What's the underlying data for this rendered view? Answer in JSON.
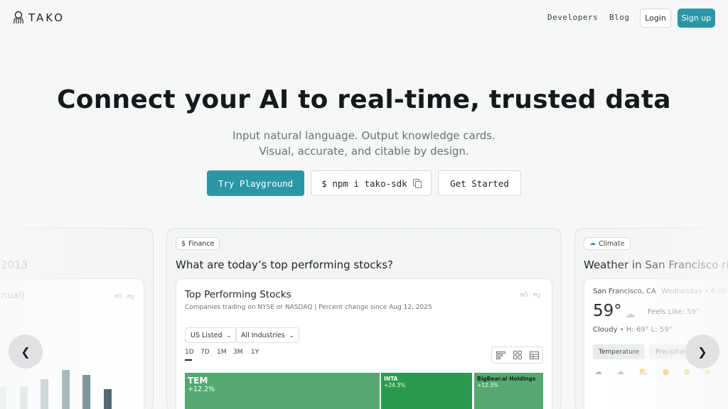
{
  "header": {
    "logo_text": "TAKO",
    "nav": [
      "Developers",
      "Blog"
    ],
    "login": "Login",
    "signup": "Sign up"
  },
  "hero": {
    "title": "Connect your AI to real-time, trusted data",
    "subtitle_line1": "Input natural language. Output knowledge cards.",
    "subtitle_line2": "Visual, accurate, and citable by design.",
    "cta_primary": "Try Playground",
    "cta_npm": "$ npm i tako-sdk",
    "cta_start": "Get Started"
  },
  "left_card": {
    "title_fragment": "2013",
    "subtitle_fragment": "nual)",
    "bar_values": [
      54,
      54,
      65,
      78,
      71,
      51
    ]
  },
  "main_card": {
    "tag": "Finance",
    "tag_icon": "$",
    "question": "What are today’s top performing stocks?",
    "chart_title": "Top Performing Stocks",
    "chart_subtitle": "Companies trading on NYSE or NASDAQ | Percent change since Aug 12, 2025",
    "filters": [
      "US Listed",
      "All Industries"
    ],
    "ranges": [
      "1D",
      "7D",
      "1M",
      "3M",
      "1Y"
    ],
    "active_range": "1D",
    "tiles": [
      {
        "symbol": "TEM",
        "change": "+12.2%"
      },
      {
        "symbol": "INTA",
        "change": "+24.3%"
      },
      {
        "symbol": "BigBear.ai Holdings",
        "change": "+12.3%"
      }
    ]
  },
  "right_card": {
    "tag": "Climate",
    "question": "Weather in San Francisco rig",
    "location": "San Francisco, CA",
    "day": "Wednesday • 8:00",
    "temp": "59°",
    "feels_like": "Feels Like: 59°",
    "condition": "Cloudy",
    "hilo": "• H: 69° L: 59°",
    "tabs": [
      "Temperature",
      "Precipitati"
    ]
  },
  "colors": {
    "accent": "#2b97a6",
    "tile_green": "#55a970",
    "tile_dark_green": "#2a9a4f"
  }
}
